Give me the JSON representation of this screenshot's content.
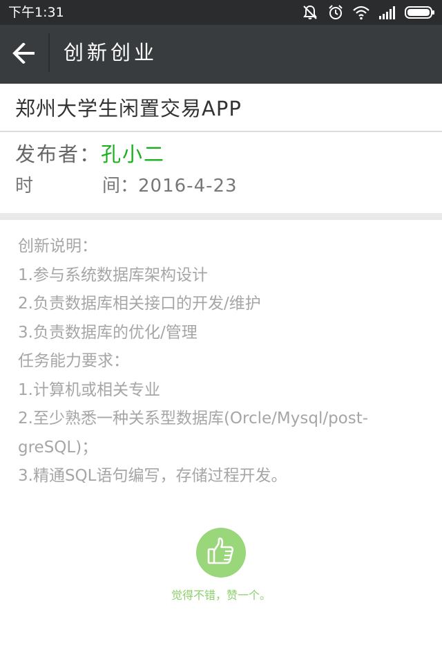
{
  "status_bar": {
    "time": "下午1:31",
    "icons": [
      "notifications-off-icon",
      "alarm-icon",
      "wifi-icon",
      "signal-icon",
      "battery-icon"
    ]
  },
  "header": {
    "back_icon": "back-arrow-icon",
    "title": "创新创业"
  },
  "post": {
    "title": "郑州大学生闲置交易APP",
    "publisher_label": "发布者：",
    "publisher_name": "孔小二",
    "time_label": "时　间：",
    "time_label_a": "时",
    "time_label_b": "间：",
    "time_value": "2016-4-23",
    "description_lines": [
      "创新说明：",
      "1.参与系统数据库架构设计",
      "2.负责数据库相关接口的开发/维护",
      "3.负责数据库的优化/管理",
      "任务能力要求：",
      "1.计算机或相关专业",
      "2.至少熟悉一种关系型数据库(Orcle/Mysql/post-",
      "greSQL)；",
      "3.精通SQL语句编写，存储过程开发。"
    ]
  },
  "like": {
    "icon": "thumbs-up-icon",
    "caption": "觉得不错，赞一个。"
  },
  "colors": {
    "status_bar_bg": "#2a2c2e",
    "title_bar_bg": "#393c3f",
    "publisher_green": "#16b11a",
    "like_green": "#9ad77b"
  }
}
